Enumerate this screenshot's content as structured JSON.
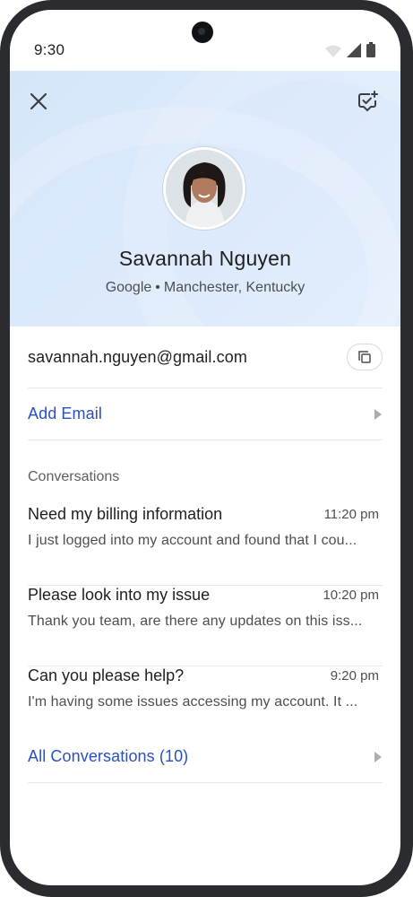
{
  "status_bar": {
    "time": "9:30"
  },
  "contact": {
    "name": "Savannah Nguyen",
    "company": "Google",
    "separator": "•",
    "location": "Manchester, Kentucky",
    "email": "savannah.nguyen@gmail.com"
  },
  "actions": {
    "add_email": "Add Email",
    "all_conversations": "All Conversations (10)"
  },
  "conversations_label": "Conversations",
  "conversations": [
    {
      "title": "Need my billing information",
      "time": "11:20 pm",
      "preview": "I just logged into my account and found that I cou..."
    },
    {
      "title": "Please look into my issue",
      "time": "10:20 pm",
      "preview": "Thank you team, are there any updates on this iss..."
    },
    {
      "title": "Can you please help?",
      "time": "9:20 pm",
      "preview": "I'm having some issues accessing my account. It ..."
    }
  ],
  "icons": {
    "close": "close-icon",
    "add_task": "add-task-icon",
    "copy": "copy-icon",
    "chevron": "chevron-right-icon"
  },
  "colors": {
    "accent": "#2850c6",
    "header_bg": "#dbe9fb",
    "text_primary": "#1f1f1f",
    "text_secondary": "#4a4f55"
  }
}
